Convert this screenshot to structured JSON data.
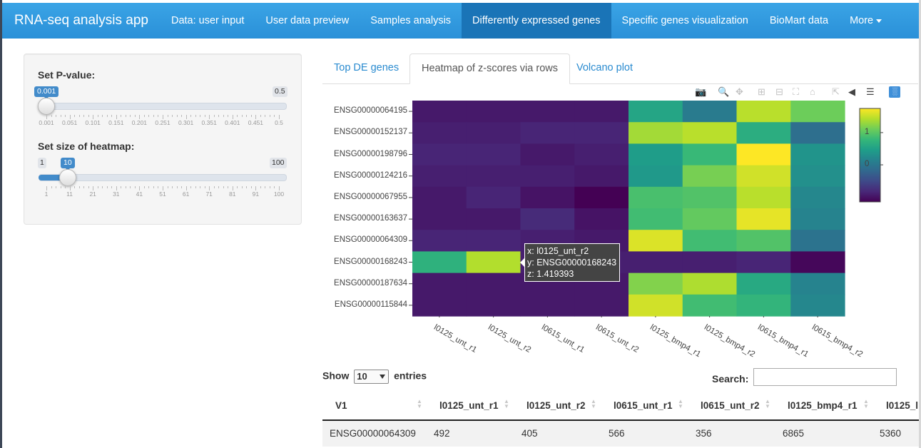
{
  "navbar": {
    "brand": "RNA-seq analysis app",
    "items": [
      {
        "label": "Data: user input"
      },
      {
        "label": "User data preview"
      },
      {
        "label": "Samples analysis"
      },
      {
        "label": "Differently expressed genes",
        "active": true
      },
      {
        "label": "Specific genes visualization"
      },
      {
        "label": "BioMart data"
      },
      {
        "label": "More"
      }
    ]
  },
  "sidebar": {
    "pvalue": {
      "label": "Set P-value:",
      "min": "0.001",
      "max": "0.5",
      "value": "0.001",
      "value_fraction": 0.0,
      "grid": [
        "0.001",
        "0.051",
        "0.101",
        "0.151",
        "0.201",
        "0.251",
        "0.301",
        "0.351",
        "0.401",
        "0.451",
        "0.5"
      ]
    },
    "heatmap_size": {
      "label": "Set size of heatmap:",
      "min": "1",
      "max": "100",
      "value": "10",
      "value_fraction": 0.0909,
      "grid": [
        "1",
        "11",
        "21",
        "31",
        "41",
        "51",
        "61",
        "71",
        "81",
        "91",
        "100"
      ]
    }
  },
  "tabs": [
    {
      "label": "Top DE genes"
    },
    {
      "label": "Heatmap of z-scores via rows",
      "active": true
    },
    {
      "label": "Volcano plot"
    }
  ],
  "modebar_icons": [
    "camera-icon",
    "zoom-icon",
    "pan-icon",
    "zoom-in-icon",
    "zoom-out-icon",
    "autoscale-icon",
    "reset-axes-icon",
    "spike-lines-icon",
    "hover-closest-icon",
    "hover-compare-icon",
    "plotly-logo-icon"
  ],
  "chart_data": {
    "type": "heatmap",
    "x": [
      "l0125_unt_r1",
      "l0125_unt_r2",
      "l0615_unt_r1",
      "l0615_unt_r2",
      "l0125_bmp4_r1",
      "l0125_bmp4_r2",
      "l0615_bmp4_r1",
      "l0615_bmp4_r2"
    ],
    "y": [
      "ENSG00000064195",
      "ENSG00000152137",
      "ENSG00000198796",
      "ENSG00000124216",
      "ENSG00000067955",
      "ENSG00000163637",
      "ENSG00000064309",
      "ENSG00000168243",
      "ENSG00000187634",
      "ENSG00000115844"
    ],
    "z": [
      [
        -0.95,
        -0.95,
        -0.95,
        -0.95,
        0.55,
        0.05,
        1.45,
        1.1
      ],
      [
        -0.9,
        -0.9,
        -0.85,
        -0.85,
        1.35,
        1.45,
        0.65,
        -0.1
      ],
      [
        -0.85,
        -0.85,
        -0.95,
        -0.9,
        0.45,
        0.8,
        1.75,
        0.35
      ],
      [
        -0.9,
        -0.9,
        -0.9,
        -0.95,
        0.4,
        1.15,
        1.55,
        0.3
      ],
      [
        -0.95,
        -0.85,
        -1.0,
        -1.15,
        0.9,
        0.95,
        1.45,
        0.2
      ],
      [
        -0.95,
        -0.95,
        -0.8,
        -1.0,
        0.85,
        1.05,
        1.65,
        0.15
      ],
      [
        -0.85,
        -0.85,
        -0.9,
        -0.95,
        1.6,
        0.85,
        0.95,
        -0.05
      ],
      [
        0.7,
        1.42,
        -0.9,
        -0.9,
        -0.9,
        -0.9,
        -0.85,
        -1.1
      ],
      [
        -0.95,
        -0.95,
        -0.95,
        -0.95,
        1.2,
        1.4,
        0.6,
        0.15
      ],
      [
        -0.95,
        -0.95,
        -0.95,
        -0.95,
        1.55,
        0.85,
        0.75,
        0.2
      ]
    ],
    "colorscale": "viridis",
    "zmin": -1.15,
    "zmax": 1.75,
    "colorbar_ticks": [
      "1",
      "0"
    ],
    "colorbar_tick_values": [
      1,
      0
    ],
    "tooltip": {
      "x": "x: l0125_unt_r2",
      "y": "y: ENSG00000168243",
      "z": "z: 1.419393"
    }
  },
  "table": {
    "show_label": "Show",
    "entries_value": "10",
    "entries_label": "entries",
    "search_label": "Search:",
    "search_value": "",
    "columns": [
      "V1",
      "l0125_unt_r1",
      "l0125_unt_r2",
      "l0615_unt_r1",
      "l0615_unt_r2",
      "l0125_bmp4_r1",
      "l0125_l"
    ],
    "rows": [
      [
        "ENSG00000064309",
        "492",
        "405",
        "566",
        "356",
        "6865",
        "5360"
      ]
    ]
  }
}
